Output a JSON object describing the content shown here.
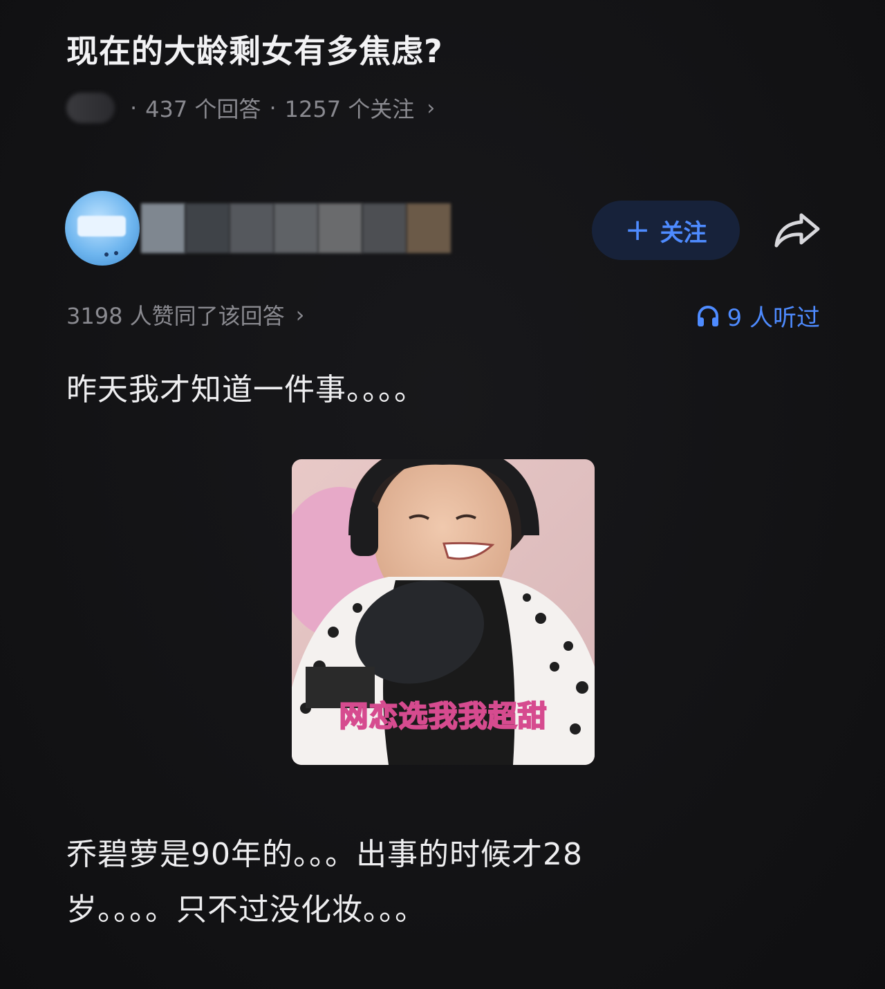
{
  "question": {
    "title": "现在的大龄剩女有多焦虑?",
    "answers_count": "437 个回答",
    "followers_count": "1257 个关注",
    "separator": "·",
    "chevron": "›"
  },
  "author": {
    "follow_label": "关注",
    "follow_icon": "+"
  },
  "stats": {
    "upvotes": "3198 人赞同了该回答",
    "upvotes_chevron": "›",
    "listened": "9 人听过",
    "accent_color": "#4e8bff"
  },
  "answer": {
    "paragraph_1": "昨天我才知道一件事。。。。",
    "image_caption": "网恋选我我超甜",
    "paragraph_2_line_1": "乔碧萝是90年的。。。出事的时候才28",
    "paragraph_2_line_2": "岁。。。。只不过没化妆。。。"
  }
}
